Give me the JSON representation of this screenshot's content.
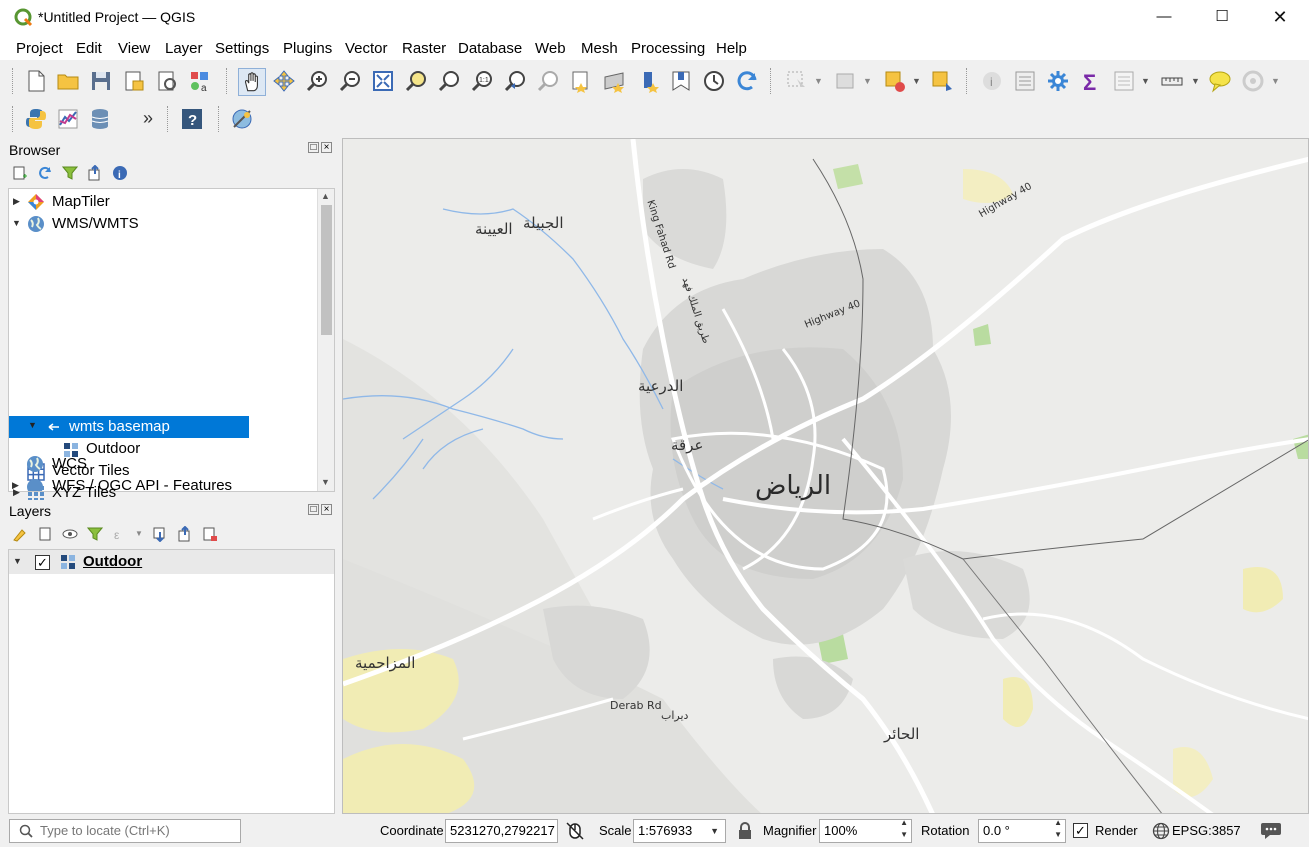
{
  "window": {
    "title": "*Untitled Project — QGIS"
  },
  "menu": [
    "Project",
    "Edit",
    "View",
    "Layer",
    "Settings",
    "Plugins",
    "Vector",
    "Raster",
    "Database",
    "Web",
    "Mesh",
    "Processing",
    "Help"
  ],
  "browser": {
    "title": "Browser",
    "items": {
      "maptiler": "MapTiler",
      "wms": "WMS/WMTS",
      "wmts_basemap": "wmts basemap",
      "outdoor": "Outdoor",
      "vector_tiles": "Vector Tiles",
      "xyz_tiles": "XYZ Tiles",
      "wcs": "WCS",
      "wfs": "WFS / OGC API - Features"
    }
  },
  "layers": {
    "title": "Layers",
    "items": {
      "outdoor": "Outdoor"
    },
    "outdoor_checked": true
  },
  "map_labels": {
    "riyadh": "الرياض",
    "diriyah": "الدرعية",
    "irqah": "عرقة",
    "jubaila": "الجبيلة",
    "uyaynah": "العيينة",
    "muzahimiyah": "المزاحمية",
    "hair": "الحائر",
    "derab": "Derab Rd",
    "derab_ar": "ديراب",
    "hwy40_a": "Highway 40",
    "hwy40_b": "Highway 40",
    "king_fahad": "King Fahad Rd",
    "king_fahad_ar": "طريق الملك فهد"
  },
  "status": {
    "locator_placeholder": "Type to locate (Ctrl+K)",
    "coordinate_label": "Coordinate",
    "coordinate_value": "5231270,2792217",
    "scale_label": "Scale",
    "scale_value": "1:576933",
    "magnifier_label": "Magnifier",
    "magnifier_value": "100%",
    "rotation_label": "Rotation",
    "rotation_value": "0.0 °",
    "render_label": "Render",
    "render_checked": true,
    "crs": "EPSG:3857"
  },
  "colors": {
    "selection": "#0078d7",
    "qgis_green": "#589632",
    "map_bg": "#ececea",
    "urban": "#d2d2d0",
    "road": "#ffffff",
    "water": "#8fb8e8",
    "park": "#b9dca0",
    "sand": "#f1ecb4"
  },
  "icons": {
    "toolbar1": [
      "new-project-icon",
      "open-project-icon",
      "save-project-icon",
      "new-print-layout-icon",
      "layout-manager-icon",
      "style-manager-icon",
      "pan-icon",
      "pan-to-selection-icon",
      "zoom-in-icon",
      "zoom-out-icon",
      "zoom-full-icon",
      "zoom-to-selection-icon",
      "zoom-to-layer-icon",
      "zoom-native-icon",
      "zoom-last-icon",
      "zoom-next-icon",
      "new-bookmark-icon",
      "show-bookmarks-icon",
      "new-map-view-icon",
      "spatial-bookmark-icon",
      "temporal-controller-icon",
      "refresh-icon",
      "select-features-icon",
      "deselect-icon",
      "select-by-location-icon",
      "attribute-table-icon",
      "identify-icon",
      "open-field-calculator-icon",
      "processing-toolbox-icon",
      "statistics-sum-icon",
      "attribute-form-icon",
      "measure-icon",
      "map-tips-icon",
      "touch-zoom-icon"
    ],
    "toolbar2": [
      "python-console-icon",
      "plugin-chart-icon",
      "db-manager-icon",
      "more-chevron-icon",
      "help-icon",
      "georeferencer-icon"
    ]
  }
}
